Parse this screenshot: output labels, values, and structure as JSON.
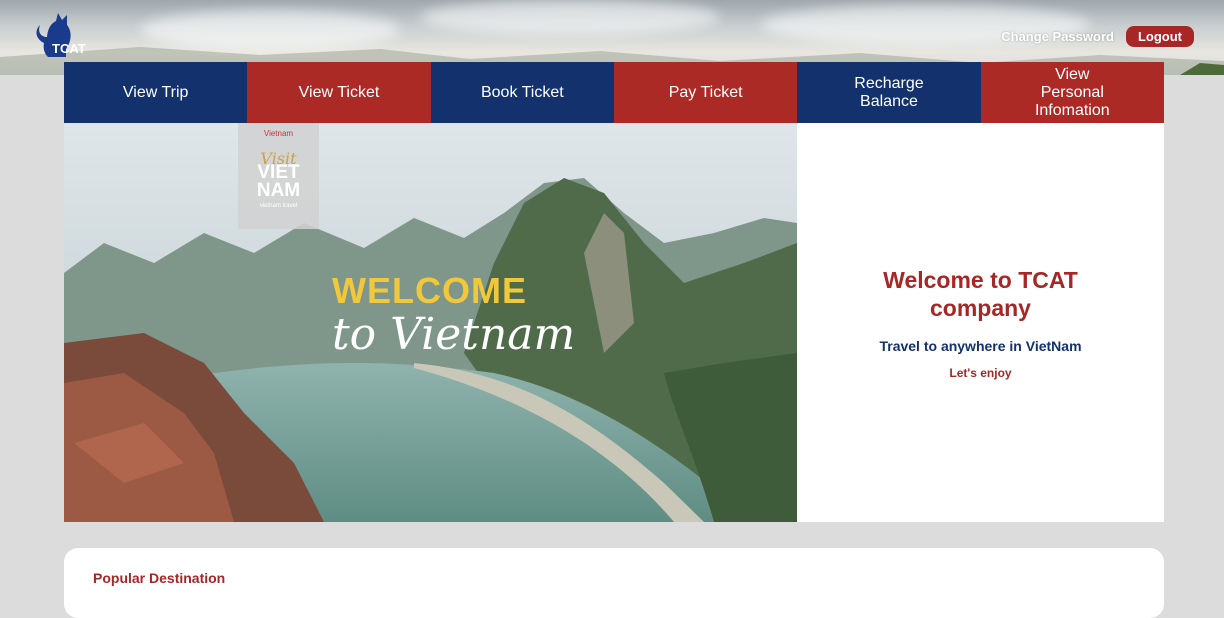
{
  "brand": {
    "name": "TCAT"
  },
  "header": {
    "change_password": "Change Password",
    "logout": "Logout"
  },
  "nav": {
    "items": [
      {
        "label": "View Trip",
        "color": "#12316d"
      },
      {
        "label": "View Ticket",
        "color": "#ab2a26"
      },
      {
        "label": "Book Ticket",
        "color": "#12316d"
      },
      {
        "label": "Pay Ticket",
        "color": "#ab2a26"
      },
      {
        "label": "Recharge Balance",
        "color": "#12316d"
      },
      {
        "label": "View Personal Infomation",
        "color": "#ab2a26"
      }
    ]
  },
  "hero": {
    "image": {
      "badge_brand": "Vietnam",
      "badge_visit": "Visit",
      "badge_big": "VIET NAM",
      "badge_small": "vietnam travel",
      "welcome": "WELCOME",
      "script": "to Vietnam"
    },
    "title": "Welcome to TCAT company",
    "subtitle": "Travel to anywhere in VietNam",
    "tagline": "Let's enjoy"
  },
  "popular": {
    "title": "Popular Destination"
  },
  "colors": {
    "navy": "#12316d",
    "red": "#ab2a26",
    "background": "#dcdcdc"
  }
}
